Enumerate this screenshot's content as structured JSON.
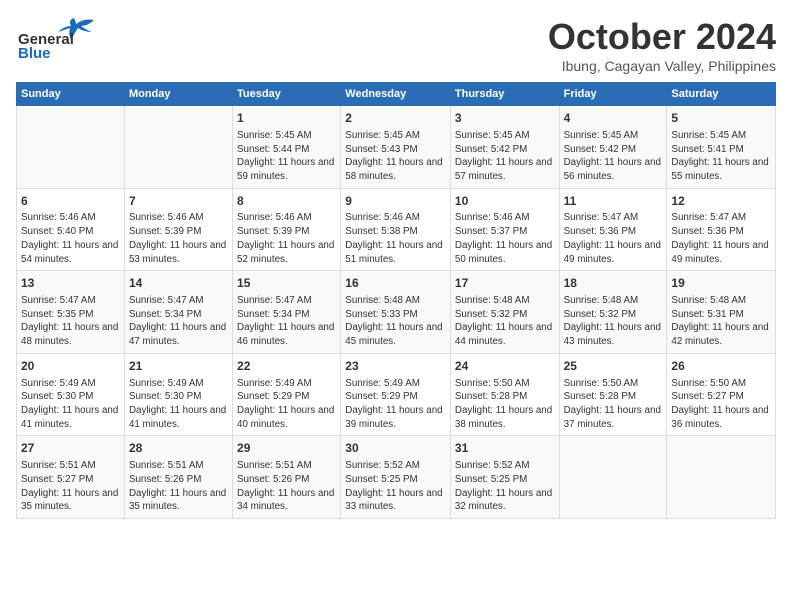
{
  "logo": {
    "line1": "General",
    "line2": "Blue"
  },
  "title": "October 2024",
  "location": "Ibung, Cagayan Valley, Philippines",
  "days_of_week": [
    "Sunday",
    "Monday",
    "Tuesday",
    "Wednesday",
    "Thursday",
    "Friday",
    "Saturday"
  ],
  "weeks": [
    [
      {
        "day": "",
        "info": ""
      },
      {
        "day": "",
        "info": ""
      },
      {
        "day": "1",
        "info": "Sunrise: 5:45 AM\nSunset: 5:44 PM\nDaylight: 11 hours and 59 minutes."
      },
      {
        "day": "2",
        "info": "Sunrise: 5:45 AM\nSunset: 5:43 PM\nDaylight: 11 hours and 58 minutes."
      },
      {
        "day": "3",
        "info": "Sunrise: 5:45 AM\nSunset: 5:42 PM\nDaylight: 11 hours and 57 minutes."
      },
      {
        "day": "4",
        "info": "Sunrise: 5:45 AM\nSunset: 5:42 PM\nDaylight: 11 hours and 56 minutes."
      },
      {
        "day": "5",
        "info": "Sunrise: 5:45 AM\nSunset: 5:41 PM\nDaylight: 11 hours and 55 minutes."
      }
    ],
    [
      {
        "day": "6",
        "info": "Sunrise: 5:46 AM\nSunset: 5:40 PM\nDaylight: 11 hours and 54 minutes."
      },
      {
        "day": "7",
        "info": "Sunrise: 5:46 AM\nSunset: 5:39 PM\nDaylight: 11 hours and 53 minutes."
      },
      {
        "day": "8",
        "info": "Sunrise: 5:46 AM\nSunset: 5:39 PM\nDaylight: 11 hours and 52 minutes."
      },
      {
        "day": "9",
        "info": "Sunrise: 5:46 AM\nSunset: 5:38 PM\nDaylight: 11 hours and 51 minutes."
      },
      {
        "day": "10",
        "info": "Sunrise: 5:46 AM\nSunset: 5:37 PM\nDaylight: 11 hours and 50 minutes."
      },
      {
        "day": "11",
        "info": "Sunrise: 5:47 AM\nSunset: 5:36 PM\nDaylight: 11 hours and 49 minutes."
      },
      {
        "day": "12",
        "info": "Sunrise: 5:47 AM\nSunset: 5:36 PM\nDaylight: 11 hours and 49 minutes."
      }
    ],
    [
      {
        "day": "13",
        "info": "Sunrise: 5:47 AM\nSunset: 5:35 PM\nDaylight: 11 hours and 48 minutes."
      },
      {
        "day": "14",
        "info": "Sunrise: 5:47 AM\nSunset: 5:34 PM\nDaylight: 11 hours and 47 minutes."
      },
      {
        "day": "15",
        "info": "Sunrise: 5:47 AM\nSunset: 5:34 PM\nDaylight: 11 hours and 46 minutes."
      },
      {
        "day": "16",
        "info": "Sunrise: 5:48 AM\nSunset: 5:33 PM\nDaylight: 11 hours and 45 minutes."
      },
      {
        "day": "17",
        "info": "Sunrise: 5:48 AM\nSunset: 5:32 PM\nDaylight: 11 hours and 44 minutes."
      },
      {
        "day": "18",
        "info": "Sunrise: 5:48 AM\nSunset: 5:32 PM\nDaylight: 11 hours and 43 minutes."
      },
      {
        "day": "19",
        "info": "Sunrise: 5:48 AM\nSunset: 5:31 PM\nDaylight: 11 hours and 42 minutes."
      }
    ],
    [
      {
        "day": "20",
        "info": "Sunrise: 5:49 AM\nSunset: 5:30 PM\nDaylight: 11 hours and 41 minutes."
      },
      {
        "day": "21",
        "info": "Sunrise: 5:49 AM\nSunset: 5:30 PM\nDaylight: 11 hours and 41 minutes."
      },
      {
        "day": "22",
        "info": "Sunrise: 5:49 AM\nSunset: 5:29 PM\nDaylight: 11 hours and 40 minutes."
      },
      {
        "day": "23",
        "info": "Sunrise: 5:49 AM\nSunset: 5:29 PM\nDaylight: 11 hours and 39 minutes."
      },
      {
        "day": "24",
        "info": "Sunrise: 5:50 AM\nSunset: 5:28 PM\nDaylight: 11 hours and 38 minutes."
      },
      {
        "day": "25",
        "info": "Sunrise: 5:50 AM\nSunset: 5:28 PM\nDaylight: 11 hours and 37 minutes."
      },
      {
        "day": "26",
        "info": "Sunrise: 5:50 AM\nSunset: 5:27 PM\nDaylight: 11 hours and 36 minutes."
      }
    ],
    [
      {
        "day": "27",
        "info": "Sunrise: 5:51 AM\nSunset: 5:27 PM\nDaylight: 11 hours and 35 minutes."
      },
      {
        "day": "28",
        "info": "Sunrise: 5:51 AM\nSunset: 5:26 PM\nDaylight: 11 hours and 35 minutes."
      },
      {
        "day": "29",
        "info": "Sunrise: 5:51 AM\nSunset: 5:26 PM\nDaylight: 11 hours and 34 minutes."
      },
      {
        "day": "30",
        "info": "Sunrise: 5:52 AM\nSunset: 5:25 PM\nDaylight: 11 hours and 33 minutes."
      },
      {
        "day": "31",
        "info": "Sunrise: 5:52 AM\nSunset: 5:25 PM\nDaylight: 11 hours and 32 minutes."
      },
      {
        "day": "",
        "info": ""
      },
      {
        "day": "",
        "info": ""
      }
    ]
  ]
}
